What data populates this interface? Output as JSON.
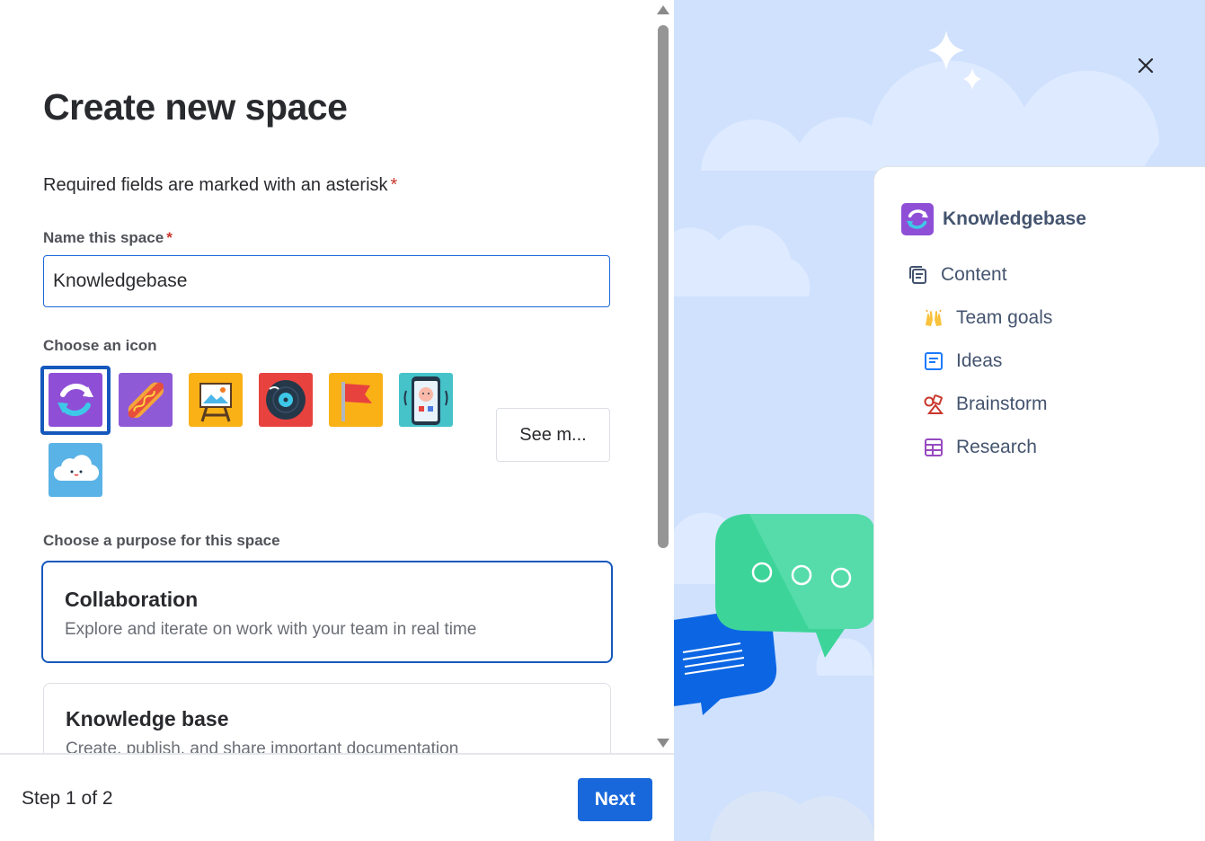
{
  "form": {
    "title": "Create new space",
    "required_note": "Required fields are marked with an asterisk",
    "asterisk": "*",
    "name_label": "Name this space",
    "name_value": "Knowledgebase",
    "icon_label": "Choose an icon",
    "see_more_label": "See m...",
    "purpose_label": "Choose a purpose for this space",
    "purposes": [
      {
        "title": "Collaboration",
        "description": "Explore and iterate on work with your team in real time",
        "selected": true
      },
      {
        "title": "Knowledge base",
        "description": "Create, publish, and share important documentation",
        "selected": false
      }
    ],
    "icons": [
      "sync-arrows-icon",
      "hotdog-icon",
      "easel-icon",
      "vinyl-record-icon",
      "flag-icon",
      "phone-character-icon",
      "cloud-face-icon"
    ],
    "selected_icon": "sync-arrows-icon"
  },
  "footer": {
    "step_text": "Step 1 of 2",
    "next_label": "Next"
  },
  "preview": {
    "space_name": "Knowledgebase",
    "content_label": "Content",
    "items": [
      {
        "label": "Team goals",
        "icon": "raising-hands-emoji"
      },
      {
        "label": "Ideas",
        "icon": "page-icon"
      },
      {
        "label": "Brainstorm",
        "icon": "whiteboard-shapes-icon"
      },
      {
        "label": "Research",
        "icon": "database-table-icon"
      }
    ]
  },
  "colors": {
    "primary": "#1868db",
    "selected_border": "#1558bc",
    "required": "#c9372c",
    "illustration_bg": "#cfe1fd"
  }
}
